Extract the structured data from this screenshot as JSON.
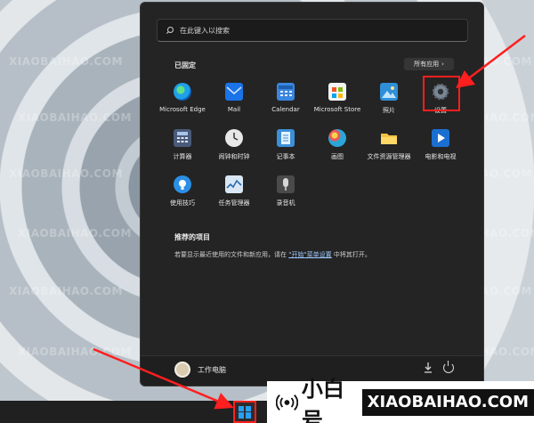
{
  "search": {
    "placeholder": "在此键入以搜索"
  },
  "pinned": {
    "title": "已固定",
    "all_apps_label": "所有应用",
    "apps": [
      {
        "label": "Microsoft Edge",
        "icon": "edge-icon",
        "color": "#1fa0e8"
      },
      {
        "label": "Mail",
        "icon": "mail-icon",
        "color": "#1a73e8"
      },
      {
        "label": "Calendar",
        "icon": "calendar-icon",
        "color": "#3a86e0"
      },
      {
        "label": "Microsoft Store",
        "icon": "store-icon",
        "color": "#f3f3f3"
      },
      {
        "label": "照片",
        "icon": "photos-icon",
        "color": "#2f8fd8"
      },
      {
        "label": "设置",
        "icon": "gear-icon",
        "color": "#7c8794"
      },
      {
        "label": "计算器",
        "icon": "calculator-icon",
        "color": "#4a5a7a"
      },
      {
        "label": "闹钟和时钟",
        "icon": "clock-icon",
        "color": "#e8e8e8"
      },
      {
        "label": "记事本",
        "icon": "notepad-icon",
        "color": "#3c8fd8"
      },
      {
        "label": "画图",
        "icon": "paint-icon",
        "color": "#2aa6d9"
      },
      {
        "label": "文件资源管理器",
        "icon": "folder-icon",
        "color": "#f5c242"
      },
      {
        "label": "电影和电视",
        "icon": "movies-icon",
        "color": "#1b6fd1"
      },
      {
        "label": "使用技巧",
        "icon": "tips-icon",
        "color": "#2b8fe6"
      },
      {
        "label": "任务管理器",
        "icon": "task-manager-icon",
        "color": "#6fa0d0"
      },
      {
        "label": "录音机",
        "icon": "recorder-icon",
        "color": "#4a4a4a"
      }
    ]
  },
  "recommended": {
    "title": "推荐的项目",
    "text_before": "若要显示最近使用的文件和新应用，请在 ",
    "link": "\"开始\"菜单设置",
    "text_after": " 中将其打开。"
  },
  "footer": {
    "user_name": "工作电脑"
  },
  "brand": {
    "cn": "小白号",
    "en": "XIAOBAIHAO.COM"
  },
  "watermark": "XIAOBAIHAO.COM",
  "accent_color": "#ff1f1f"
}
